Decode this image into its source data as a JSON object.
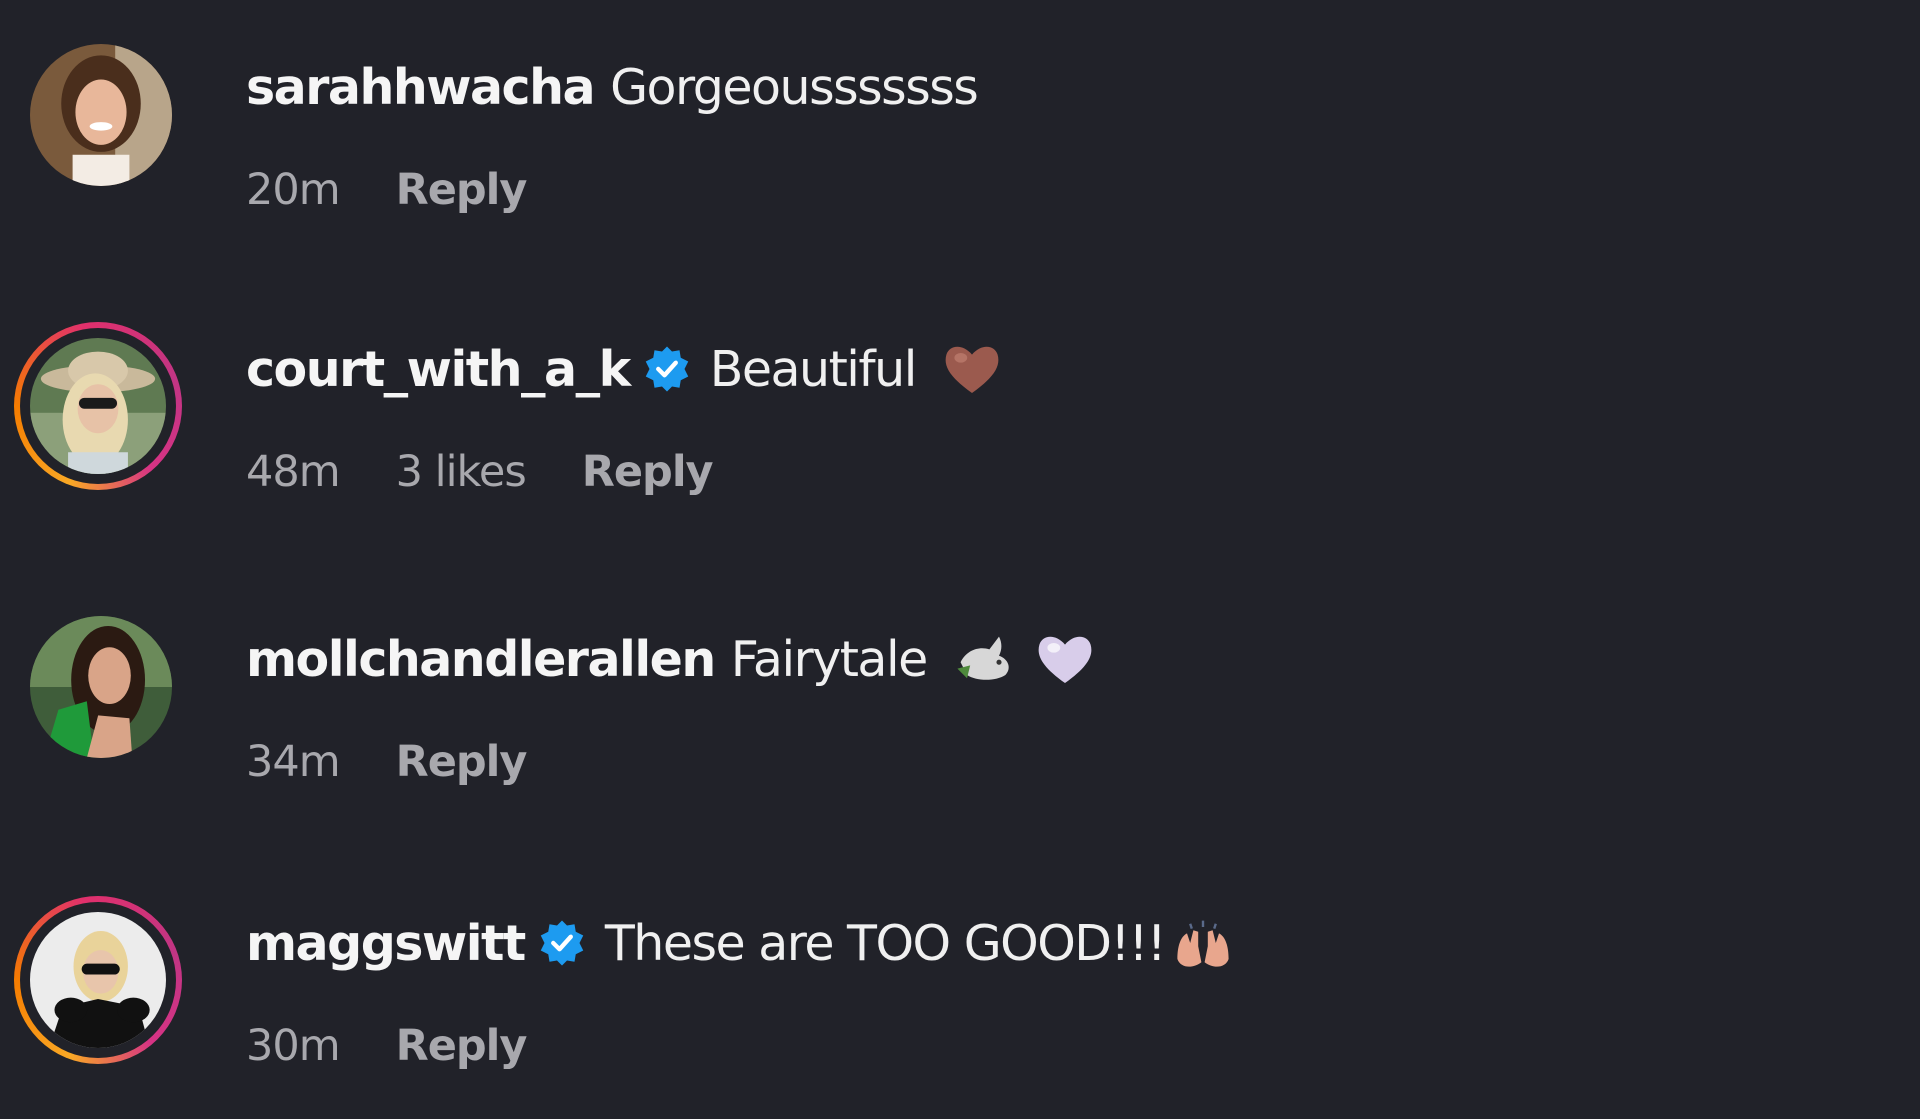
{
  "comments": [
    {
      "username": "sarahhwacha",
      "verified": false,
      "text": "Gorgeousssssss",
      "emoji": [],
      "time": "20m",
      "likes": "",
      "reply_label": "Reply",
      "story_ring": false
    },
    {
      "username": "court_with_a_k",
      "verified": true,
      "text": "Beautiful",
      "emoji": [
        "brown-heart-icon"
      ],
      "time": "48m",
      "likes": "3 likes",
      "reply_label": "Reply",
      "story_ring": true
    },
    {
      "username": "mollchandlerallen",
      "verified": false,
      "text": "Fairytale",
      "emoji": [
        "dove-icon",
        "white-heart-icon"
      ],
      "time": "34m",
      "likes": "",
      "reply_label": "Reply",
      "story_ring": false
    },
    {
      "username": "maggswitt",
      "verified": true,
      "text": "These are TOO GOOD!!!",
      "emoji": [
        "raising-hands-icon"
      ],
      "time": "30m",
      "likes": "",
      "reply_label": "Reply",
      "story_ring": true
    }
  ],
  "colors": {
    "background": "#212229",
    "username": "#f5f5f5",
    "meta": "#a8a8ad",
    "verified_badge": "#1d9bf0"
  }
}
